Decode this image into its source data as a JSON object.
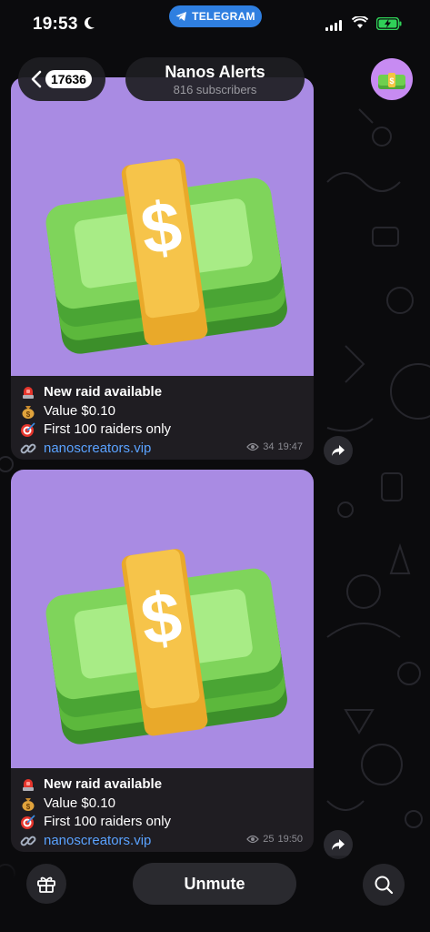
{
  "status_bar": {
    "time": "19:53",
    "app_pill": "TELEGRAM",
    "icons": [
      "moon-icon",
      "signal-icon",
      "wifi-icon",
      "battery-charging-icon"
    ]
  },
  "header": {
    "back_count": "17636",
    "title": "Nanos Alerts",
    "subtitle": "816 subscribers"
  },
  "posts": [
    {
      "lines": [
        {
          "icon": "rotating-light-icon",
          "text": "New raid available"
        },
        {
          "icon": "money-bag-icon",
          "text": "Value $0.10"
        },
        {
          "icon": "target-icon",
          "text": "First 100 raiders only"
        },
        {
          "icon": "link-icon",
          "text": "nanoscreators.vip"
        }
      ],
      "views": "34",
      "time": "19:47"
    },
    {
      "lines": [
        {
          "icon": "rotating-light-icon",
          "text": "New raid available"
        },
        {
          "icon": "money-bag-icon",
          "text": "Value $0.10"
        },
        {
          "icon": "target-icon",
          "text": "First 100 raiders only"
        },
        {
          "icon": "link-icon",
          "text": "nanoscreators.vip"
        }
      ],
      "views": "25",
      "time": "19:50"
    }
  ],
  "bottom": {
    "unmute_label": "Unmute",
    "icons": [
      "gift-icon",
      "search-icon"
    ]
  },
  "colors": {
    "accent": "#2f7fe0",
    "link": "#5aa2ff",
    "image_bg": "#a98be3",
    "bubble": "#1f1d22"
  }
}
